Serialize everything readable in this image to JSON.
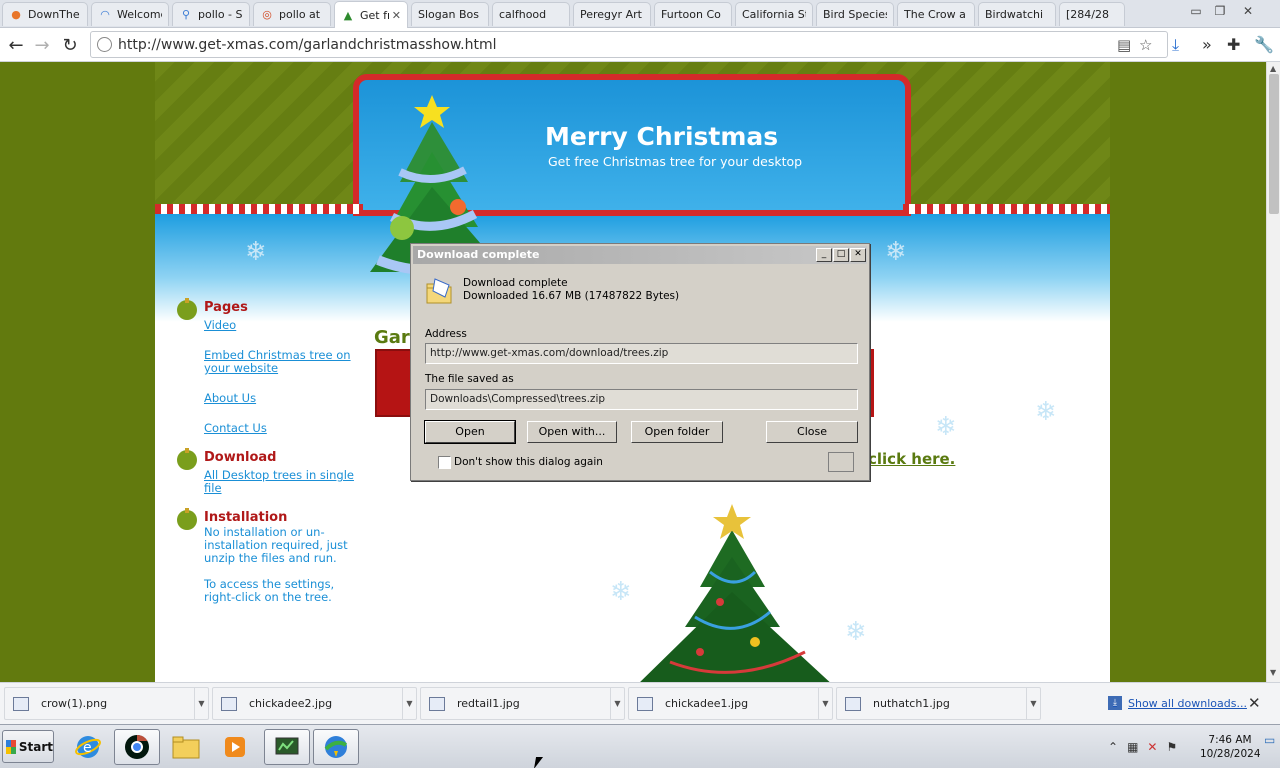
{
  "tabs": [
    {
      "title": "DownThe",
      "favicon": "firefox-icon"
    },
    {
      "title": "Welcome",
      "favicon": "loading-icon"
    },
    {
      "title": "pollo - Se",
      "favicon": "search-icon"
    },
    {
      "title": "pollo at D",
      "favicon": "opera-icon"
    },
    {
      "title": "Get fr",
      "favicon": "tree-icon",
      "active": true
    },
    {
      "title": "Slogan Bos",
      "favicon": "blank-icon"
    },
    {
      "title": "calfhood",
      "favicon": "blank-icon"
    },
    {
      "title": "Peregyr Art",
      "favicon": "blank-icon"
    },
    {
      "title": "Furtoon Co",
      "favicon": "blank-icon"
    },
    {
      "title": "California St",
      "favicon": "blank-icon"
    },
    {
      "title": "Bird Species",
      "favicon": "blank-icon"
    },
    {
      "title": "The Crow a",
      "favicon": "blank-icon"
    },
    {
      "title": "Birdwatchi",
      "favicon": "blank-icon"
    },
    {
      "title": "[284/28",
      "favicon": "blank-icon"
    }
  ],
  "address_bar": {
    "url": "http://www.get-xmas.com/garlandchristmasshow.html"
  },
  "page": {
    "banner_title": "Merry Christmas",
    "banner_subtitle": "Get free Christmas tree for your desktop",
    "sidebar": {
      "pages_heading": "Pages",
      "pages_links": [
        "Video",
        "Embed Christmas tree on your website",
        "About Us",
        "Contact Us"
      ],
      "download_heading": "Download",
      "download_link": "All Desktop trees in single file",
      "installation_heading": "Installation",
      "installation_text_1": "No installation or un-installation required, just unzip the files and run.",
      "installation_text_2": "To access the settings, right-click on the tree."
    },
    "garland_heading": "Garl",
    "click_here": "click here."
  },
  "dialog": {
    "title": "Download complete",
    "status": "Download complete",
    "downloaded": "Downloaded 16.67 MB (17487822 Bytes)",
    "address_label": "Address",
    "address_value": "http://www.get-xmas.com/download/trees.zip",
    "saved_label": "The file saved as",
    "saved_value": "Downloads\\Compressed\\trees.zip",
    "buttons": {
      "open": "Open",
      "open_with": "Open with...",
      "open_folder": "Open folder",
      "close": "Close"
    },
    "checkbox_label": "Don't show this dialog again"
  },
  "downloads_shelf": {
    "items": [
      "crow(1).png",
      "chickadee2.jpg",
      "redtail1.jpg",
      "chickadee1.jpg",
      "nuthatch1.jpg"
    ],
    "show_all": "Show all downloads..."
  },
  "taskbar": {
    "start_label": "Start",
    "clock_time": "7:46 AM",
    "clock_date": "10/28/2024"
  }
}
